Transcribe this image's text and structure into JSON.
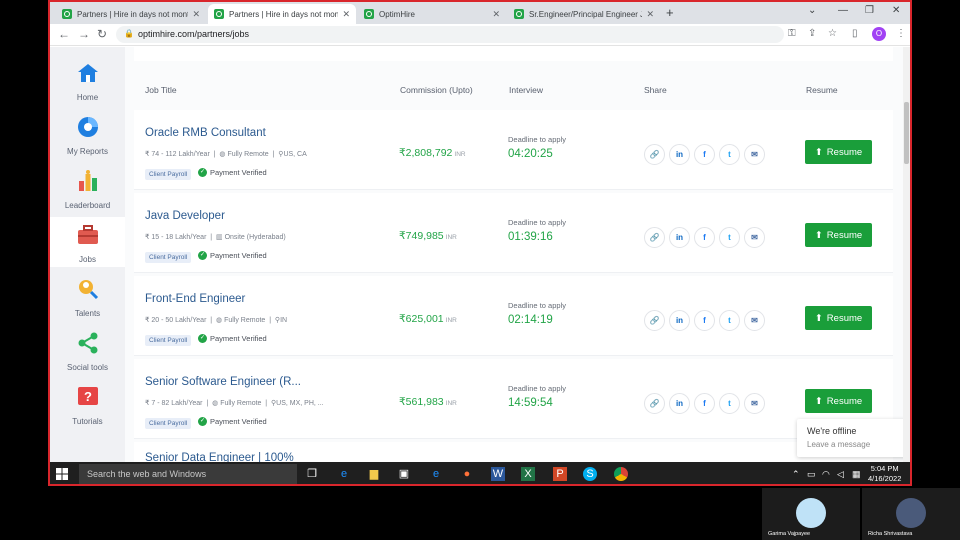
{
  "browser": {
    "tabs": [
      {
        "title": "Partners | Hire in days not months",
        "active": false
      },
      {
        "title": "Partners | Hire in days not months",
        "active": true
      },
      {
        "title": "OptimHire",
        "active": false
      },
      {
        "title": "Sr.Engineer/Principal Engineer Jo",
        "active": false
      }
    ],
    "url": "optimhire.com/partners/jobs",
    "profile_initial": "O"
  },
  "sidebar": {
    "items": [
      {
        "label": "Home",
        "icon": "home-icon"
      },
      {
        "label": "My Reports",
        "icon": "pie-chart-icon"
      },
      {
        "label": "Leaderboard",
        "icon": "leaderboard-icon"
      },
      {
        "label": "Jobs",
        "icon": "briefcase-icon"
      },
      {
        "label": "Talents",
        "icon": "talent-search-icon"
      },
      {
        "label": "Social tools",
        "icon": "share-icon"
      },
      {
        "label": "Tutorials",
        "icon": "help-icon"
      }
    ],
    "active_index": 3
  },
  "table": {
    "headers": {
      "title": "Job Title",
      "commission": "Commission (Upto)",
      "interview": "Interview",
      "share": "Share",
      "resume": "Resume"
    },
    "rows": [
      {
        "title": "Oracle RMB Consultant",
        "salary": "₹ 74 - 112 Lakh/Year",
        "mode": "Fully Remote",
        "location": "US, CA",
        "tag": "Client Payroll",
        "verified": "Payment Verified",
        "commission": "₹2,808,792",
        "currency": "INR",
        "deadline_label": "Deadline to apply",
        "timer": "04:20:25",
        "button": "Resume"
      },
      {
        "title": "Java Developer",
        "salary": "₹ 15 - 18 Lakh/Year",
        "mode": "Onsite (Hyderabad)",
        "location": "",
        "tag": "Client Payroll",
        "verified": "Payment Verified",
        "commission": "₹749,985",
        "currency": "INR",
        "deadline_label": "Deadline to apply",
        "timer": "01:39:16",
        "button": "Resume"
      },
      {
        "title": "Front-End Engineer",
        "salary": "₹ 20 - 50 Lakh/Year",
        "mode": "Fully Remote",
        "location": "IN",
        "tag": "Client Payroll",
        "verified": "Payment Verified",
        "commission": "₹625,001",
        "currency": "INR",
        "deadline_label": "Deadline to apply",
        "timer": "02:14:19",
        "button": "Resume"
      },
      {
        "title": "Senior Software Engineer (R...",
        "salary": "₹ 7 - 82 Lakh/Year",
        "mode": "Fully Remote",
        "location": "US, MX, PH, ...",
        "tag": "Client Payroll",
        "verified": "Payment Verified",
        "commission": "₹561,983",
        "currency": "INR",
        "deadline_label": "Deadline to apply",
        "timer": "14:59:54",
        "button": "Resume"
      }
    ],
    "partial_row_title": "Senior Data Engineer | 100%"
  },
  "chat": {
    "status": "We're offline",
    "subtitle": "Leave a message"
  },
  "taskbar": {
    "search_placeholder": "Search the web and Windows",
    "time": "5:04 PM",
    "date": "4/16/2022"
  },
  "video_tiles": [
    {
      "name": "Garima Vajpayee"
    },
    {
      "name": "Richa Shrivastava"
    }
  ],
  "colors": {
    "accent_green": "#1a9e3a",
    "link_blue": "#2c5a8f",
    "frame_red": "#d9262c"
  }
}
